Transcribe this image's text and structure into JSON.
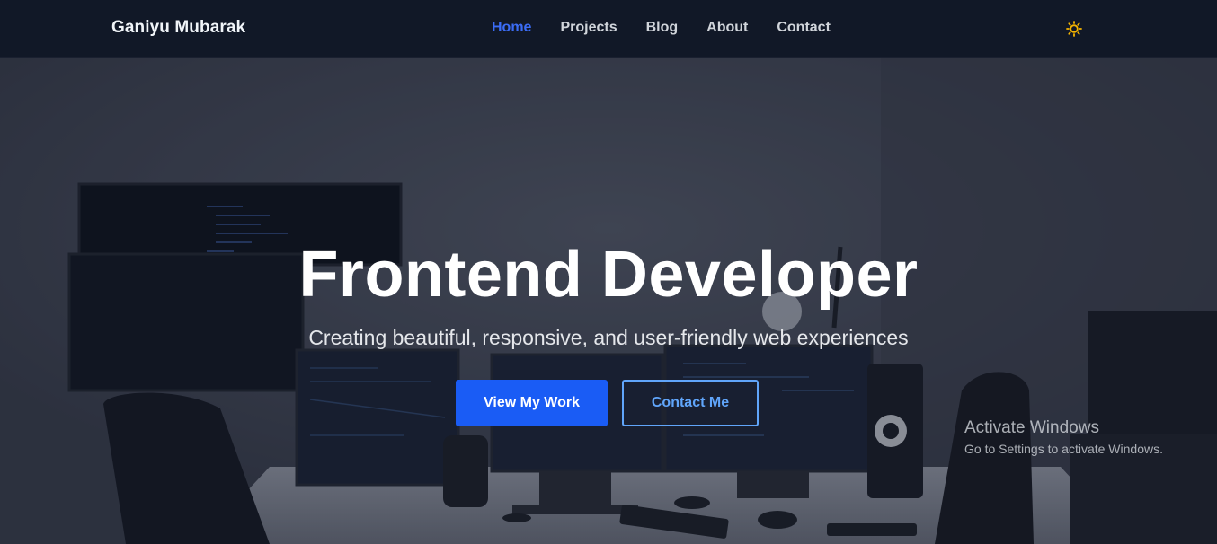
{
  "brand": {
    "name": "Ganiyu Mubarak"
  },
  "nav": {
    "items": [
      {
        "label": "Home",
        "active": true
      },
      {
        "label": "Projects",
        "active": false
      },
      {
        "label": "Blog",
        "active": false
      },
      {
        "label": "About",
        "active": false
      },
      {
        "label": "Contact",
        "active": false
      }
    ],
    "theme_icon": "sun-icon"
  },
  "hero": {
    "title": "Frontend Developer",
    "subtitle": "Creating beautiful, responsive, and user-friendly web experiences",
    "primary_button": "View My Work",
    "secondary_button": "Contact Me"
  },
  "watermark": {
    "title": "Activate Windows",
    "subtitle": "Go to Settings to activate Windows."
  },
  "colors": {
    "navbar_bg": "#111827",
    "accent": "#1a5cf5",
    "active_link": "#3b6cf5",
    "outline": "#60a5fa",
    "sun": "#f5b400"
  }
}
